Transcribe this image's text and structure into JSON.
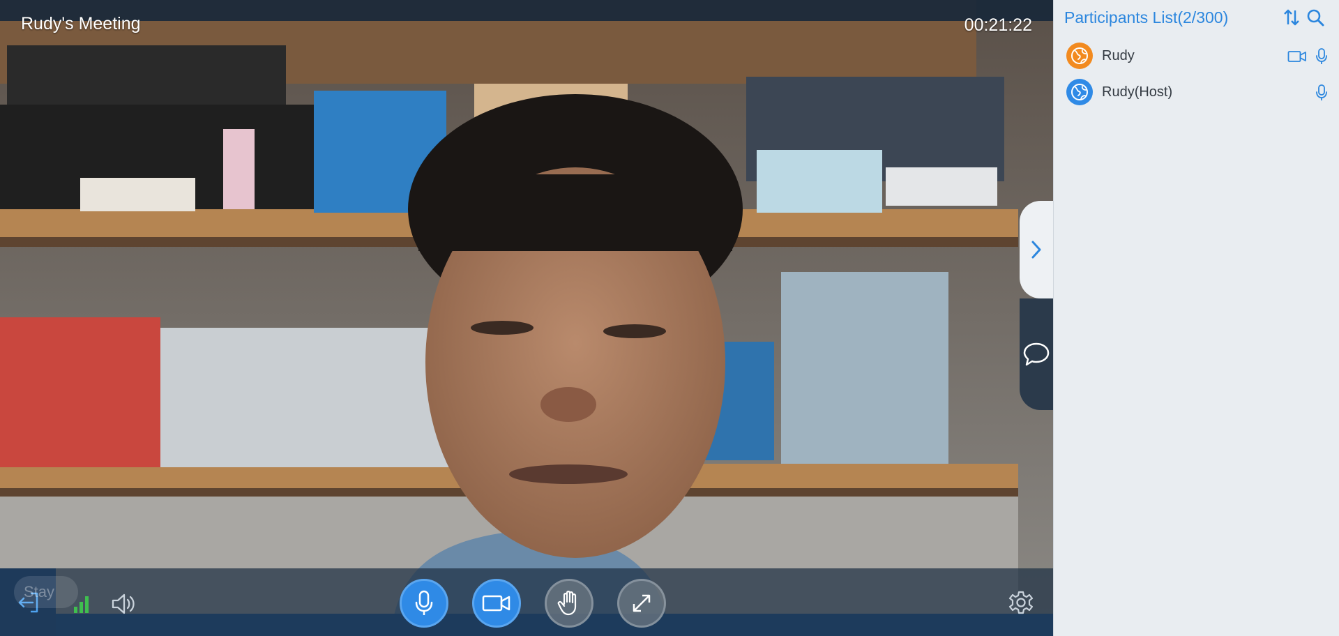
{
  "meeting": {
    "title": "Rudy's Meeting",
    "elapsed": "00:21:22"
  },
  "controls": {
    "leave_icon": "exit-icon",
    "network_icon": "signal-bars-icon",
    "speaker_icon": "speaker-icon",
    "mute_state": "unmuted",
    "video_state": "on",
    "raise_hand_icon": "hand-icon",
    "fullscreen_icon": "expand-icon",
    "settings_icon": "gear-icon",
    "ghost_tooltip": "Stay"
  },
  "sidebar": {
    "title": "Participants List(2/300)",
    "participants": [
      {
        "name": "Rudy",
        "avatar_color": "#f28a1f",
        "video": true,
        "audio": true
      },
      {
        "name": "Rudy(Host)",
        "avatar_color": "#2f8ae6",
        "video": false,
        "audio": true
      }
    ]
  },
  "colors": {
    "accent": "#2b86de",
    "active_button": "#2f8ae6",
    "signal_green": "#3fbf4f"
  }
}
